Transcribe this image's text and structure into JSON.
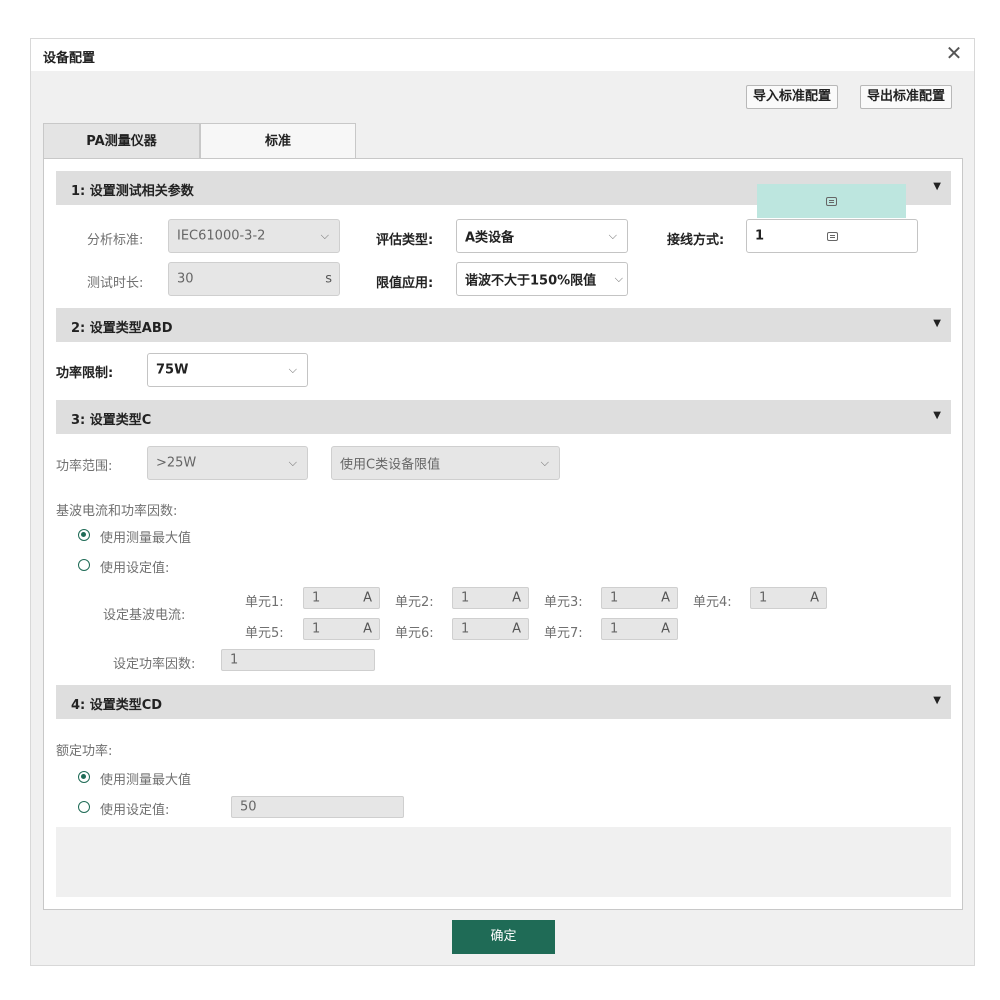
{
  "window": {
    "title": "设备配置"
  },
  "toolbar": {
    "import_label": "导入标准配置",
    "export_label": "导出标准配置"
  },
  "tabs": [
    {
      "label": "PA测量仪器",
      "active": false
    },
    {
      "label": "标准",
      "active": true
    }
  ],
  "section1": {
    "title": "1: 设置测试相关参数",
    "analysis_standard": {
      "label": "分析标准:",
      "value": "IEC61000-3-2"
    },
    "eval_type": {
      "label": "评估类型:",
      "value": "A类设备"
    },
    "wiring": {
      "label": "接线方式:",
      "value": "1"
    },
    "test_duration": {
      "label": "测试时长:",
      "value": "30",
      "unit": "s"
    },
    "limit_apply": {
      "label": "限值应用:",
      "value": "谐波不大于150%限值"
    }
  },
  "section2": {
    "title": "2: 设置类型ABD",
    "power_limit": {
      "label": "功率限制:",
      "value": "75W"
    }
  },
  "section3": {
    "title": "3: 设置类型C",
    "power_range": {
      "label": "功率范围:",
      "value": ">25W"
    },
    "c_limit": {
      "value": "使用C类设备限值"
    },
    "fundamental_label": "基波电流和功率因数:",
    "use_max_label": "使用测量最大值",
    "use_set_label": "使用设定值:",
    "set_current_label": "设定基波电流:",
    "units": [
      {
        "label": "单元1:",
        "value": "1",
        "unit": "A"
      },
      {
        "label": "单元2:",
        "value": "1",
        "unit": "A"
      },
      {
        "label": "单元3:",
        "value": "1",
        "unit": "A"
      },
      {
        "label": "单元4:",
        "value": "1",
        "unit": "A"
      },
      {
        "label": "单元5:",
        "value": "1",
        "unit": "A"
      },
      {
        "label": "单元6:",
        "value": "1",
        "unit": "A"
      },
      {
        "label": "单元7:",
        "value": "1",
        "unit": "A"
      }
    ],
    "pf_label": "设定功率因数:",
    "pf_value": "1"
  },
  "section4": {
    "title": "4: 设置类型CD",
    "rated_power_label": "额定功率:",
    "use_max_label": "使用测量最大值",
    "use_set_label": "使用设定值:",
    "set_value": "50"
  },
  "footer": {
    "ok_label": "确定"
  },
  "colors": {
    "accent": "#1f6b56",
    "header_bg": "#dedede",
    "tooltip_bg": "#bde6df"
  },
  "icons": [
    "close-icon",
    "chevron-down-icon",
    "collapse-arrow-icon",
    "radio-icon",
    "screen-icon"
  ]
}
